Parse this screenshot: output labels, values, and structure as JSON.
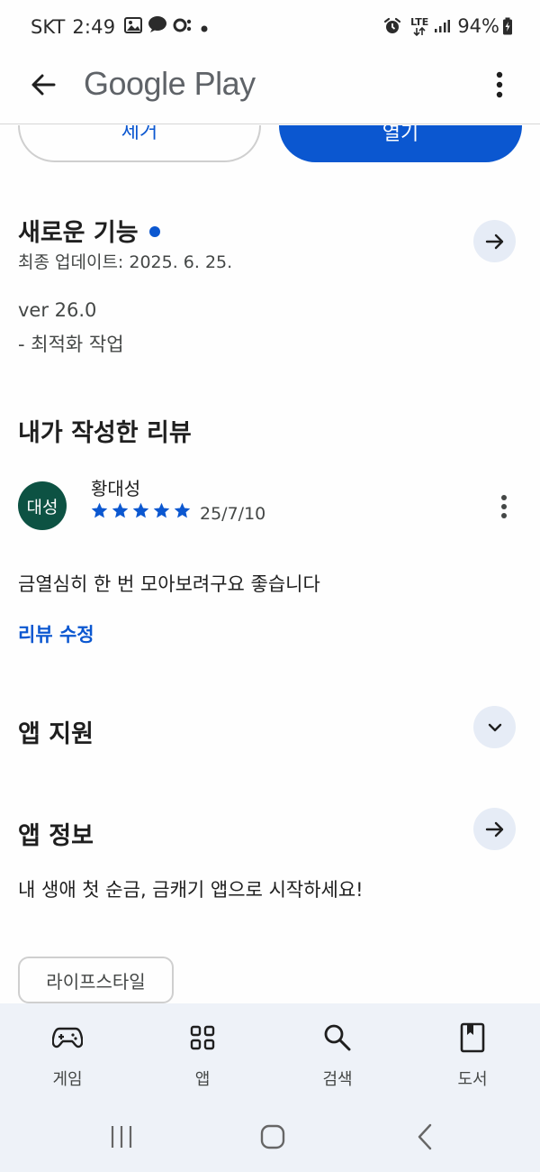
{
  "status_bar": {
    "carrier": "SKT",
    "time": "2:49",
    "network": "LTE",
    "battery": "94%"
  },
  "app_bar": {
    "title": "Google Play"
  },
  "actions": {
    "remove_label": "제거",
    "open_label": "열기"
  },
  "whats_new": {
    "title": "새로운 기능",
    "last_updated": "최종 업데이트: 2025. 6. 25.",
    "version": "ver 26.0",
    "note": "- 최적화 작업"
  },
  "my_review": {
    "title": "내가 작성한 리뷰",
    "avatar_text": "대성",
    "reviewer": "황대성",
    "rating": 5,
    "date": "25/7/10",
    "text": "금열심히 한 번 모아보려구요 좋습니다",
    "edit_label": "리뷰 수정"
  },
  "app_support": {
    "title": "앱 지원"
  },
  "about": {
    "title": "앱 정보",
    "description": "내 생애 첫 순금, 금캐기 앱으로 시작하세요!",
    "category": "라이프스타일"
  },
  "bottom_nav": {
    "items": [
      {
        "label": "게임",
        "icon": "gamepad-icon"
      },
      {
        "label": "앱",
        "icon": "apps-grid-icon"
      },
      {
        "label": "검색",
        "icon": "search-icon"
      },
      {
        "label": "도서",
        "icon": "book-icon"
      }
    ]
  },
  "colors": {
    "accent": "#0b57d0",
    "avatar_bg": "#0d5243",
    "nav_bg": "#eef2f8"
  }
}
